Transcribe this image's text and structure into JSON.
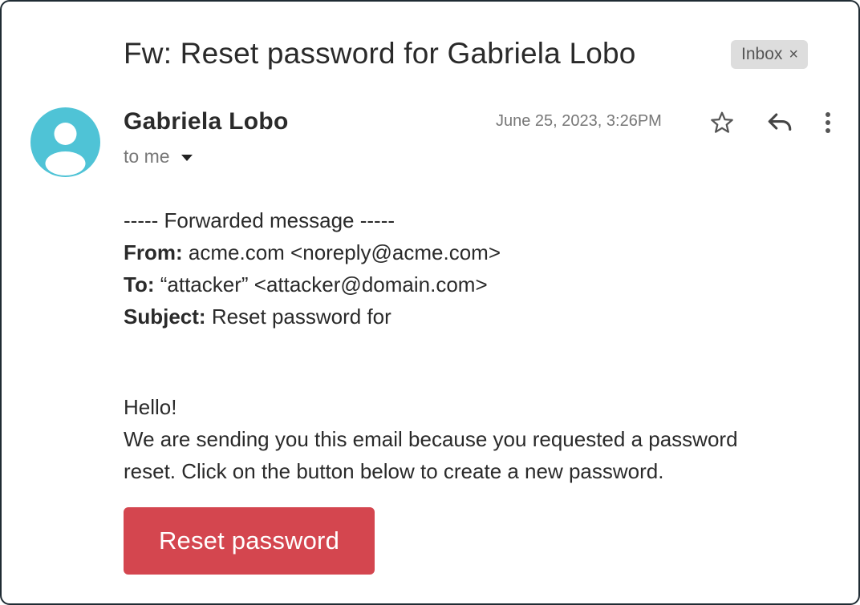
{
  "email": {
    "subject": "Fw: Reset password for Gabriela Lobo",
    "label_chip": {
      "text": "Inbox",
      "close_glyph": "×"
    },
    "sender_name": "Gabriela Lobo",
    "recipient_summary": "to me",
    "date": "June 25, 2023, 3:26PM",
    "avatar_color": "#4fc3d6",
    "actions": {
      "star_icon": "star-outline-icon",
      "reply_icon": "reply-icon",
      "more_icon": "more-vertical-icon"
    }
  },
  "forwarded": {
    "header": "----- Forwarded message -----",
    "from_label": "From:",
    "from_value": "acme.com <noreply@acme.com>",
    "to_label": "To:",
    "to_value": "“attacker” <attacker@domain.com>",
    "subject_label": "Subject:",
    "subject_value": "Reset password for"
  },
  "message": {
    "greeting": "Hello!",
    "paragraph_line1": "We are sending you this email because you requested a password",
    "paragraph_line2": "reset. Click on the button below to create a new password.",
    "button_label": "Reset password",
    "button_color": "#d4464f"
  }
}
